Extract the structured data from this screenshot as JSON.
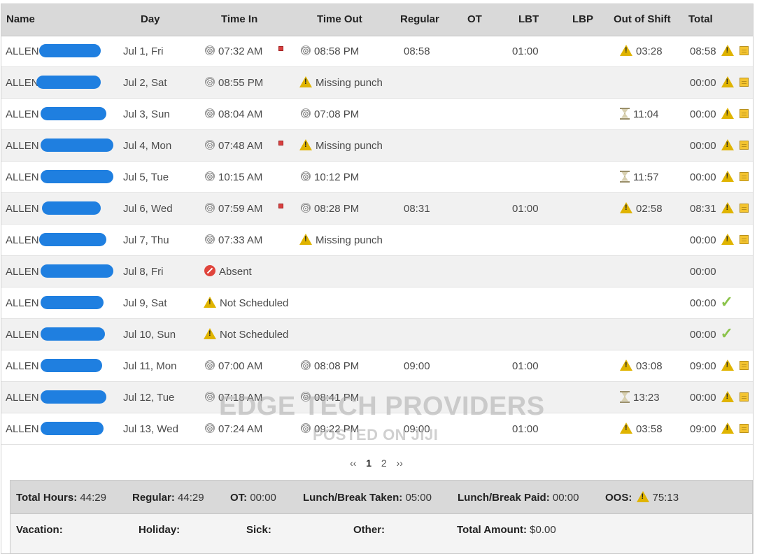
{
  "columns": [
    "Name",
    "Day",
    "Time In",
    "Time Out",
    "Regular",
    "OT",
    "LBT",
    "LBP",
    "Out of Shift",
    "Total"
  ],
  "rows": [
    {
      "name": "ALLEN",
      "day": "Jul 1, Fri",
      "in": "07:32 AM",
      "in_flag": true,
      "out_type": "punch",
      "out": "08:58 PM",
      "regular": "08:58",
      "lbt": "01:00",
      "oos_icon": "warning-icon",
      "oos": "03:28",
      "total": "08:58",
      "total_icons": [
        "warning-icon",
        "note-icon"
      ]
    },
    {
      "name": "ALLEN",
      "day": "Jul 2, Sat",
      "in": "08:55 PM",
      "in_flag": false,
      "out_type": "missing",
      "out": "Missing punch",
      "regular": "",
      "lbt": "",
      "oos_icon": "",
      "oos": "",
      "total": "00:00",
      "total_icons": [
        "warning-icon",
        "note-icon"
      ]
    },
    {
      "name": "ALLEN",
      "day": "Jul 3, Sun",
      "in": "08:04 AM",
      "in_flag": false,
      "out_type": "punch",
      "out": "07:08 PM",
      "regular": "",
      "lbt": "",
      "oos_icon": "hourglass-icon",
      "oos": "11:04",
      "total": "00:00",
      "total_icons": [
        "warning-icon",
        "note-icon"
      ]
    },
    {
      "name": "ALLEN",
      "day": "Jul 4, Mon",
      "in": "07:48 AM",
      "in_flag": true,
      "out_type": "missing",
      "out": "Missing punch",
      "regular": "",
      "lbt": "",
      "oos_icon": "",
      "oos": "",
      "total": "00:00",
      "total_icons": [
        "warning-icon",
        "note-icon"
      ]
    },
    {
      "name": "ALLEN",
      "day": "Jul 5, Tue",
      "in": "10:15 AM",
      "in_flag": false,
      "out_type": "punch",
      "out": "10:12 PM",
      "regular": "",
      "lbt": "",
      "oos_icon": "hourglass-icon",
      "oos": "11:57",
      "total": "00:00",
      "total_icons": [
        "warning-icon",
        "note-icon"
      ]
    },
    {
      "name": "ALLEN",
      "day": "Jul 6, Wed",
      "in": "07:59 AM",
      "in_flag": true,
      "out_type": "punch",
      "out": "08:28 PM",
      "regular": "08:31",
      "lbt": "01:00",
      "oos_icon": "warning-icon",
      "oos": "02:58",
      "total": "08:31",
      "total_icons": [
        "warning-icon",
        "note-icon"
      ]
    },
    {
      "name": "ALLEN",
      "day": "Jul 7, Thu",
      "in": "07:33 AM",
      "in_flag": false,
      "out_type": "missing",
      "out": "Missing punch",
      "regular": "",
      "lbt": "",
      "oos_icon": "",
      "oos": "",
      "total": "00:00",
      "total_icons": [
        "warning-icon",
        "note-icon"
      ]
    },
    {
      "name": "ALLEN",
      "day": "Jul 8, Fri",
      "in_type": "absent",
      "in": "Absent",
      "in_flag": false,
      "out_type": "none",
      "out": "",
      "regular": "",
      "lbt": "",
      "oos_icon": "",
      "oos": "",
      "total": "00:00",
      "total_icons": []
    },
    {
      "name": "ALLEN",
      "day": "Jul 9, Sat",
      "in_type": "notsched",
      "in": "Not Scheduled",
      "in_flag": false,
      "out_type": "none",
      "out": "",
      "regular": "",
      "lbt": "",
      "oos_icon": "",
      "oos": "",
      "total": "00:00",
      "total_icons": [
        "check-icon"
      ]
    },
    {
      "name": "ALLEN",
      "day": "Jul 10, Sun",
      "in_type": "notsched",
      "in": "Not Scheduled",
      "in_flag": false,
      "out_type": "none",
      "out": "",
      "regular": "",
      "lbt": "",
      "oos_icon": "",
      "oos": "",
      "total": "00:00",
      "total_icons": [
        "check-icon"
      ]
    },
    {
      "name": "ALLEN",
      "day": "Jul 11, Mon",
      "in": "07:00 AM",
      "in_flag": false,
      "out_type": "punch",
      "out": "08:08 PM",
      "regular": "09:00",
      "lbt": "01:00",
      "oos_icon": "warning-icon",
      "oos": "03:08",
      "total": "09:00",
      "total_icons": [
        "warning-icon",
        "note-icon"
      ]
    },
    {
      "name": "ALLEN",
      "day": "Jul 12, Tue",
      "in": "07:18 AM",
      "in_flag": false,
      "out_type": "punch",
      "out": "08:41 PM",
      "regular": "",
      "lbt": "",
      "oos_icon": "hourglass-icon",
      "oos": "13:23",
      "total": "00:00",
      "total_icons": [
        "warning-icon",
        "note-icon"
      ]
    },
    {
      "name": "ALLEN",
      "day": "Jul 13, Wed",
      "in": "07:24 AM",
      "in_flag": false,
      "out_type": "punch",
      "out": "09:22 PM",
      "regular": "09:00",
      "lbt": "01:00",
      "oos_icon": "warning-icon",
      "oos": "03:58",
      "total": "09:00",
      "total_icons": [
        "warning-icon",
        "note-icon"
      ]
    }
  ],
  "pager": {
    "prev": "‹‹",
    "pages": [
      "1",
      "2"
    ],
    "next": "››",
    "current": "1"
  },
  "summary": {
    "total_hours_label": "Total Hours:",
    "total_hours": "44:29",
    "regular_label": "Regular:",
    "regular": "44:29",
    "ot_label": "OT:",
    "ot": "00:00",
    "lbt_label": "Lunch/Break Taken:",
    "lbt": "05:00",
    "lbp_label": "Lunch/Break Paid:",
    "lbp": "00:00",
    "oos_label": "OOS:",
    "oos": "75:13",
    "vacation_label": "Vacation:",
    "holiday_label": "Holiday:",
    "sick_label": "Sick:",
    "other_label": "Other:",
    "amount_label": "Total Amount:",
    "amount": "$0.00"
  },
  "watermark": {
    "line1": "EDGE TECH PROVIDERS",
    "line2": "POSTED ON JIJI"
  },
  "colors": {
    "header_bg": "#d9d9d9",
    "alt_row": "#f1f1f1",
    "redaction": "#1f7fe0",
    "warning": "#e0b400",
    "check": "#8bc34a",
    "absent": "#e0443c"
  }
}
